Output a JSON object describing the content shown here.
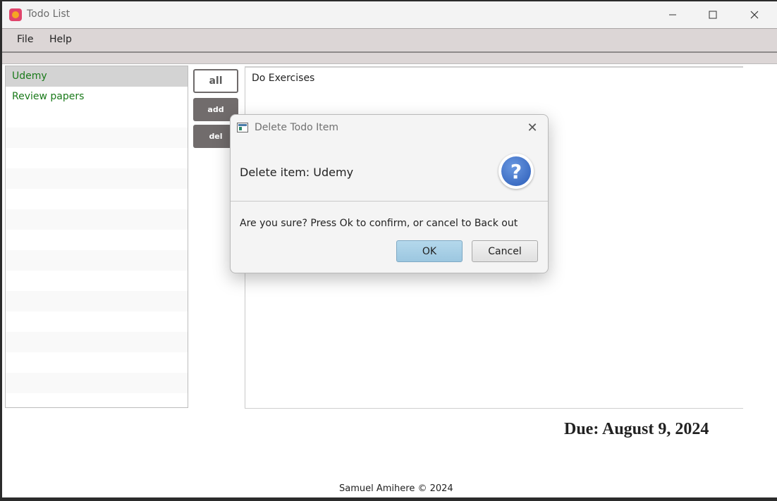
{
  "window": {
    "title": "Todo List",
    "controls": {
      "minimize_icon": "minimize-icon",
      "maximize_icon": "maximize-icon",
      "close_icon": "close-icon"
    }
  },
  "menu": {
    "items": [
      {
        "label": "File"
      },
      {
        "label": "Help"
      }
    ]
  },
  "todo_list": {
    "items": [
      {
        "label": "Udemy",
        "selected": true
      },
      {
        "label": "Review papers",
        "selected": false
      }
    ],
    "item_color": "#1a7a1a"
  },
  "side_buttons": {
    "all": "all",
    "add": "add",
    "del": "del"
  },
  "detail": {
    "text": "Do Exercises"
  },
  "due_label": "Due: August 9, 2024",
  "footer": "Samuel Amihere © 2024",
  "dialog": {
    "title": "Delete Todo Item",
    "heading": "Delete item: Udemy",
    "message": "Are you sure? Press Ok to confirm, or cancel to Back out",
    "ok_label": "OK",
    "cancel_label": "Cancel",
    "icon": "question-icon",
    "help_glyph": "?",
    "close_glyph": "✕"
  },
  "colors": {
    "menubar": "#dcd6d6",
    "dark_button": "#716c6c",
    "ok_button": "#a8d0e6"
  }
}
